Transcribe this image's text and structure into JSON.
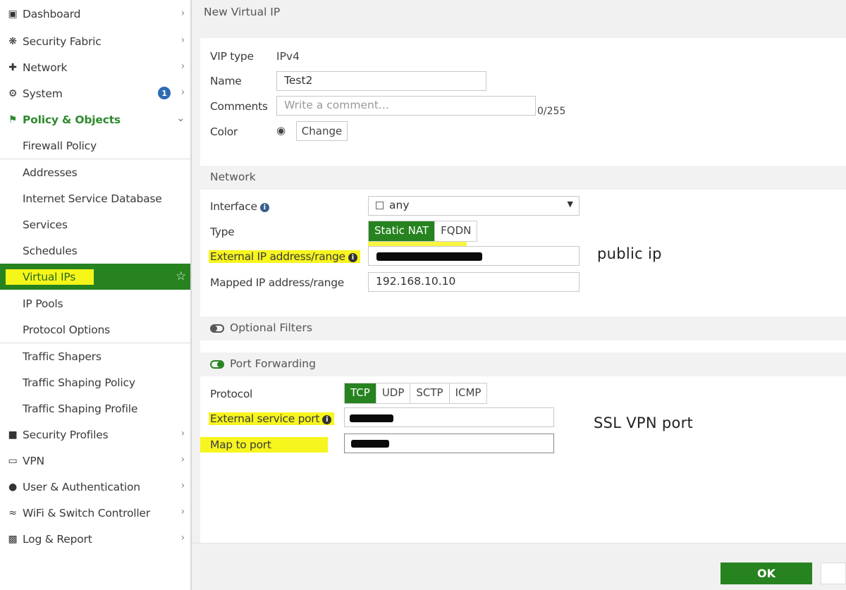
{
  "sidebar": {
    "items": [
      {
        "label": "Dashboard",
        "icon": "dashboard-icon"
      },
      {
        "label": "Security Fabric",
        "icon": "fabric-icon"
      },
      {
        "label": "Network",
        "icon": "network-icon"
      },
      {
        "label": "System",
        "icon": "gear-icon",
        "badge": "1"
      },
      {
        "label": "Policy & Objects",
        "icon": "policy-icon"
      },
      {
        "label": "Firewall Policy"
      },
      {
        "label": "Addresses"
      },
      {
        "label": "Internet Service Database"
      },
      {
        "label": "Services"
      },
      {
        "label": "Schedules"
      },
      {
        "label": "Virtual IPs"
      },
      {
        "label": "IP Pools"
      },
      {
        "label": "Protocol Options"
      },
      {
        "label": "Traffic Shapers"
      },
      {
        "label": "Traffic Shaping Policy"
      },
      {
        "label": "Traffic Shaping Profile"
      },
      {
        "label": "Security Profiles",
        "icon": "lock-icon"
      },
      {
        "label": "VPN",
        "icon": "monitor-icon"
      },
      {
        "label": "User & Authentication",
        "icon": "user-icon"
      },
      {
        "label": "WiFi & Switch Controller",
        "icon": "wifi-icon"
      },
      {
        "label": "Log & Report",
        "icon": "chart-icon"
      }
    ]
  },
  "header": {
    "title": "New Virtual IP"
  },
  "form": {
    "vip_type_label": "VIP type",
    "vip_type_value": "IPv4",
    "name_label": "Name",
    "name_value": "Test2",
    "comments_label": "Comments",
    "comments_placeholder": "Write a comment...",
    "comments_count": "0/255",
    "color_label": "Color",
    "color_change_label": "Change"
  },
  "network": {
    "section_title": "Network",
    "interface_label": "Interface",
    "interface_value": "any",
    "type_label": "Type",
    "type_options": [
      "Static NAT",
      "FQDN"
    ],
    "type_selected": "Static NAT",
    "external_ip_label": "External IP address/range",
    "mapped_ip_label": "Mapped IP address/range",
    "mapped_ip_value": "192.168.10.10"
  },
  "optional_filters": {
    "title": "Optional Filters",
    "enabled": false
  },
  "port_forwarding": {
    "title": "Port Forwarding",
    "enabled": true,
    "protocol_label": "Protocol",
    "protocol_options": [
      "TCP",
      "UDP",
      "SCTP",
      "ICMP"
    ],
    "protocol_selected": "TCP",
    "external_port_label": "External service port",
    "map_port_label": "Map to port"
  },
  "annotations": {
    "public_ip": "public ip",
    "ssl_vpn_port": "SSL VPN port"
  },
  "footer": {
    "ok_label": "OK"
  },
  "colors": {
    "accent_green": "#26831f",
    "highlight_yellow": "#f7f51e",
    "badge_blue": "#2d6bb3"
  }
}
